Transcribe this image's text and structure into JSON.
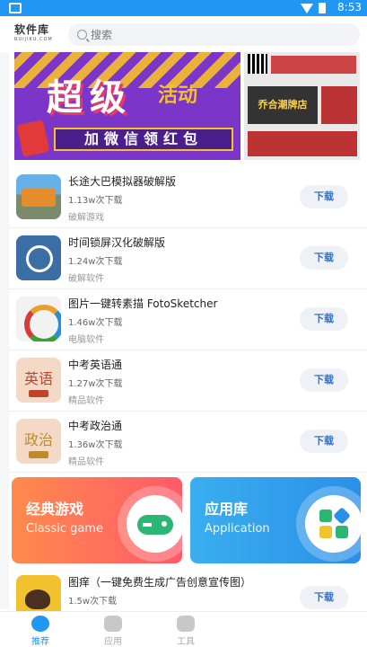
{
  "status_bar": {
    "time": "8:53"
  },
  "header": {
    "logo_cn": "软件库",
    "logo_en": "RUIJIKU.COM",
    "search_placeholder": "搜索"
  },
  "banner": {
    "headline": "超级",
    "headline_2": "活动",
    "subline": "加微信领红包",
    "shop_sign": "乔合潮牌店"
  },
  "apps": [
    {
      "name": "长途大巴模拟器破解版",
      "downloads": "1.13w次下载",
      "category": "破解游戏",
      "button": "下载",
      "icon": "bus-icon"
    },
    {
      "name": "时间锁屏汉化破解版",
      "downloads": "1.24w次下载",
      "category": "破解软件",
      "button": "下载",
      "icon": "clock-lock-icon"
    },
    {
      "name": "图片一键转素描 FotoSketcher",
      "downloads": "1.46w次下载",
      "category": "电脑软件",
      "button": "下载",
      "icon": "sketch-icon"
    },
    {
      "name": "中考英语通",
      "downloads": "1.27w次下载",
      "category": "精品软件",
      "button": "下载",
      "icon": "english-icon",
      "icon_text": "英语"
    },
    {
      "name": "中考政治通",
      "downloads": "1.36w次下载",
      "category": "精品软件",
      "button": "下载",
      "icon": "politics-icon",
      "icon_text": "政治"
    },
    {
      "name": "图痒（一键免费生成广告创意宣传图）",
      "downloads": "1.5w次下载",
      "category": "",
      "button": "下载",
      "icon": "bird-icon"
    }
  ],
  "category_cards": [
    {
      "title": "经典游戏",
      "subtitle": "Classic game",
      "icon": "gamepad-icon"
    },
    {
      "title": "应用库",
      "subtitle": "Application",
      "icon": "app-grid-icon"
    }
  ],
  "bottom_nav": [
    {
      "label": "推荐",
      "active": true
    },
    {
      "label": "应用",
      "active": false
    },
    {
      "label": "工具",
      "active": false
    }
  ],
  "colors": {
    "accent": "#2196f3",
    "button_text": "#2b72d6",
    "games_card": "#ff6a5a",
    "apps_card": "#2a8fe8"
  }
}
